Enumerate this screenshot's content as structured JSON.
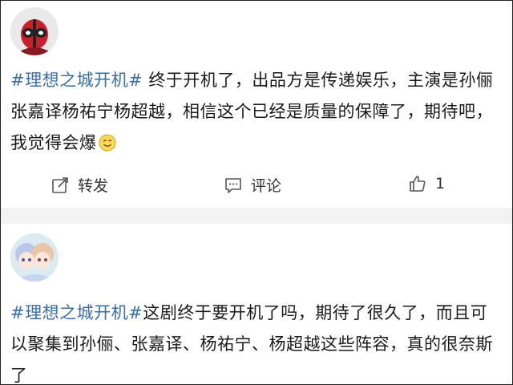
{
  "posts": [
    {
      "hashtag": "#理想之城开机#",
      "text": " 终于开机了，出品方是传递娱乐，主演是孙俪张嘉译杨祐宁杨超越，相信这个已经是质量的保障了，期待吧，我觉得会爆",
      "emoji": "smile-emoji-icon",
      "actions": {
        "repost_label": "转发",
        "comment_label": "评论",
        "like_count": "1"
      }
    },
    {
      "hashtag": "#理想之城开机#",
      "text": "这剧终于要开机了吗，期待了很久了，而且可以聚集到孙俪、张嘉译、杨祐宁、杨超越这些阵容，真的很奈斯了"
    }
  ],
  "colors": {
    "hashtag": "#3a6ea8",
    "divider": "#f2f2f2"
  }
}
